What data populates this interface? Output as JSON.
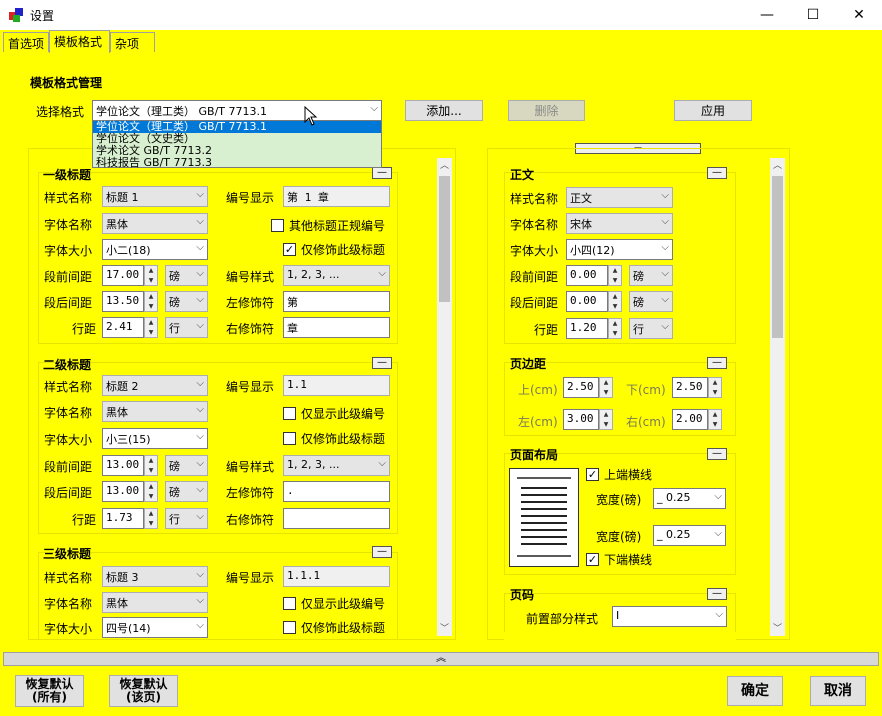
{
  "window": {
    "title": "设置",
    "minimize": "—",
    "maximize": "☐",
    "close": "✕"
  },
  "tabs": [
    "首选项",
    "模板格式",
    "杂项"
  ],
  "section_title": "模板格式管理",
  "format_row": {
    "label": "选择格式",
    "selected": "学位论文（理工类） GB/T 7713.1",
    "add_btn": "添加...",
    "delete_btn": "删除",
    "apply_btn": "应用"
  },
  "dropdown_options": [
    "学位论文（理工类） GB/T 7713.1",
    "学位论文（文史类）",
    "学术论文 GB/T 7713.2",
    "科技报告 GB/T 7713.3"
  ],
  "collapse_glyph": "—",
  "heading1": {
    "title": "一级标题",
    "style_name_label": "样式名称",
    "style_name": "标题 1",
    "font_name_label": "字体名称",
    "font_name": "黑体",
    "font_size_label": "字体大小",
    "font_size": "小二(18)",
    "space_before_label": "段前间距",
    "space_before": "17.00",
    "space_before_unit": "磅",
    "space_after_label": "段后间距",
    "space_after": "13.50",
    "space_after_unit": "磅",
    "line_spacing_label": "行距",
    "line_spacing": "2.41",
    "line_spacing_unit": "行",
    "number_display_label": "编号显示",
    "number_display": "第 1 章",
    "opt1_label": "其他标题正规编号",
    "opt1_checked": false,
    "opt2_label": "仅修饰此级标题",
    "opt2_checked": true,
    "number_style_label": "编号样式",
    "number_style": "1, 2, 3, ...",
    "left_deco_label": "左修饰符",
    "left_deco": "第",
    "right_deco_label": "右修饰符",
    "right_deco": "章"
  },
  "heading2": {
    "title": "二级标题",
    "style_name_label": "样式名称",
    "style_name": "标题 2",
    "font_name_label": "字体名称",
    "font_name": "黑体",
    "font_size_label": "字体大小",
    "font_size": "小三(15)",
    "space_before_label": "段前间距",
    "space_before": "13.00",
    "space_before_unit": "磅",
    "space_after_label": "段后间距",
    "space_after": "13.00",
    "space_after_unit": "磅",
    "line_spacing_label": "行距",
    "line_spacing": "1.73",
    "line_spacing_unit": "行",
    "number_display_label": "编号显示",
    "number_display": "1.1",
    "opt1_label": "仅显示此级编号",
    "opt1_checked": false,
    "opt2_label": "仅修饰此级标题",
    "opt2_checked": false,
    "number_style_label": "编号样式",
    "number_style": "1, 2, 3, ...",
    "left_deco_label": "左修饰符",
    "left_deco": ".",
    "right_deco_label": "右修饰符",
    "right_deco": ""
  },
  "heading3": {
    "title": "三级标题",
    "style_name_label": "样式名称",
    "style_name": "标题 3",
    "font_name_label": "字体名称",
    "font_name": "黑体",
    "font_size_label": "字体大小",
    "font_size": "四号(14)",
    "number_display_label": "编号显示",
    "number_display": "1.1.1",
    "opt1_label": "仅显示此级编号",
    "opt1_checked": false,
    "opt2_label": "仅修饰此级标题",
    "opt2_checked": false
  },
  "body_text": {
    "title": "正文",
    "style_name_label": "样式名称",
    "style_name": "正文",
    "font_name_label": "字体名称",
    "font_name": "宋体",
    "font_size_label": "字体大小",
    "font_size": "小四(12)",
    "space_before_label": "段前间距",
    "space_before": "0.00",
    "space_before_unit": "磅",
    "space_after_label": "段后间距",
    "space_after": "0.00",
    "space_after_unit": "磅",
    "line_spacing_label": "行距",
    "line_spacing": "1.20",
    "line_spacing_unit": "行"
  },
  "margins": {
    "title": "页边距",
    "top_label": "上(cm)",
    "top": "2.50",
    "bottom_label": "下(cm)",
    "bottom": "2.50",
    "left_label": "左(cm)",
    "left": "3.00",
    "right_label": "右(cm)",
    "right": "2.00"
  },
  "layout": {
    "title": "页面布局",
    "top_line_label": "上端横线",
    "top_line_checked": true,
    "width1_label": "宽度(磅)",
    "width1": "_ 0.25",
    "width2_label": "宽度(磅)",
    "width2": "_ 0.25",
    "bottom_line_label": "下端横线",
    "bottom_line_checked": true
  },
  "page_number": {
    "title": "页码",
    "front_style_label": "前置部分样式",
    "front_style": "I"
  },
  "splitter_glyph": "︽",
  "footer": {
    "restore_all": [
      "恢复默认",
      "(所有)"
    ],
    "restore_page": [
      "恢复默认",
      "(该页)"
    ],
    "ok": "确定",
    "cancel": "取消"
  },
  "colors": {
    "background": "#ffff00",
    "selection": "#0078d7"
  }
}
